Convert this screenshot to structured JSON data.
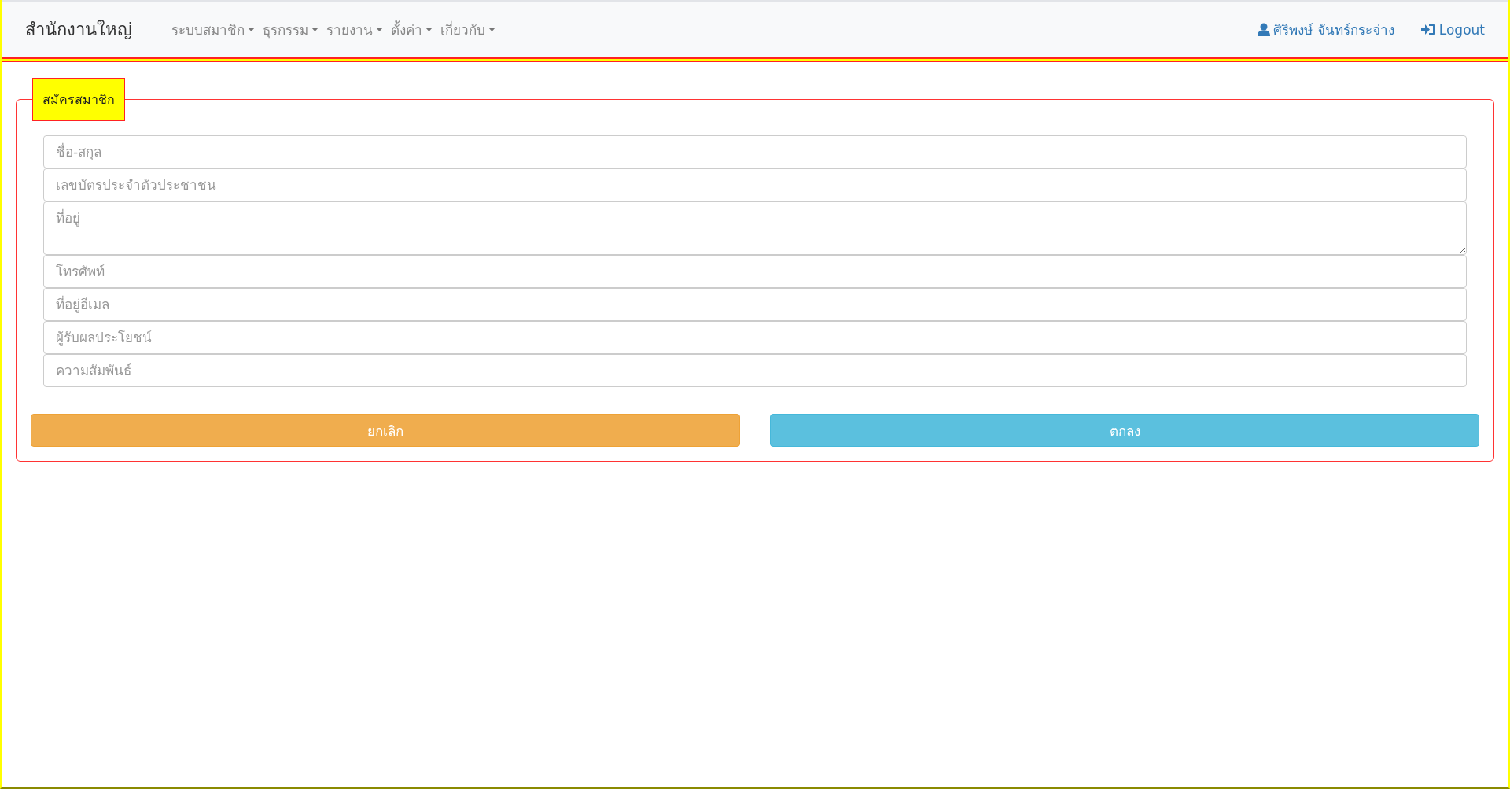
{
  "navbar": {
    "brand": "สำนักงานใหญ่",
    "menu": [
      {
        "label": "ระบบสมาชิก"
      },
      {
        "label": "ธุรกรรม"
      },
      {
        "label": "รายงาน"
      },
      {
        "label": "ตั้งค่า"
      },
      {
        "label": "เกี่ยวกับ"
      }
    ],
    "user": "ศิริพงษ์ จันทร์กระจ่าง",
    "logout": "Logout"
  },
  "form": {
    "legend": "สมัครสมาชิก",
    "fields": [
      {
        "kind": "input",
        "placeholder": "ชื่อ-สกุล"
      },
      {
        "kind": "input",
        "placeholder": "เลขบัตรประจำตัวประชาชน"
      },
      {
        "kind": "textarea",
        "placeholder": "ที่อยู่"
      },
      {
        "kind": "input",
        "placeholder": "โทรศัพท์"
      },
      {
        "kind": "input",
        "placeholder": "ที่อยู่อีเมล"
      },
      {
        "kind": "input",
        "placeholder": "ผู้รับผลประโยชน์"
      },
      {
        "kind": "input",
        "placeholder": "ความสัมพันธ์"
      }
    ],
    "buttons": [
      {
        "kind": "cancel",
        "label": "ยกเลิก"
      },
      {
        "kind": "ok",
        "label": "ตกลง"
      }
    ]
  }
}
